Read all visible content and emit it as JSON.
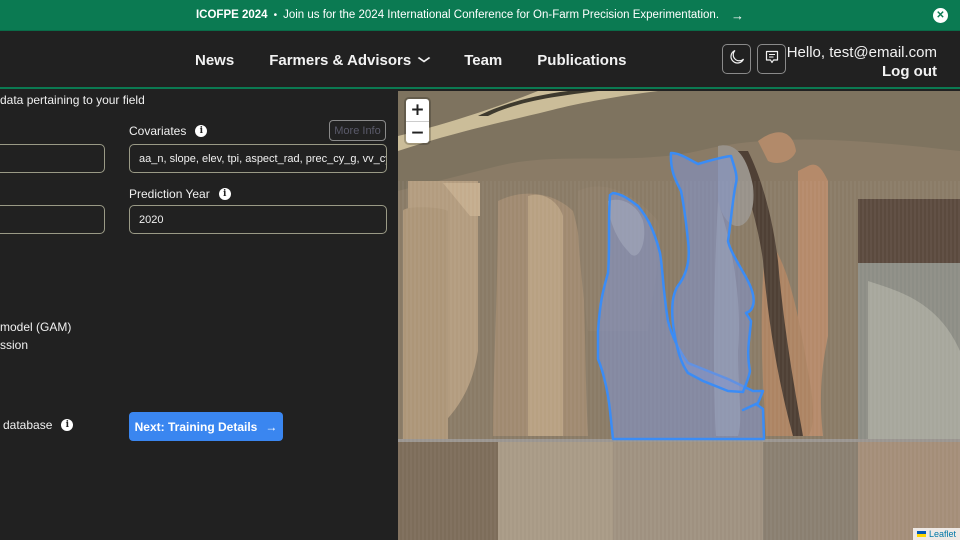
{
  "banner": {
    "title": "ICOFPE 2024",
    "separator": "•",
    "message": "Join us for the 2024 International Conference for On-Farm Precision Experimentation.",
    "arrow_icon": "→",
    "close_icon": "✕",
    "bg_color": "#0b7a52"
  },
  "nav": {
    "links": [
      {
        "label": "News"
      },
      {
        "label": "Farmers & Advisors",
        "has_dropdown": true,
        "chevron": "⌄"
      },
      {
        "label": "Team"
      },
      {
        "label": "Publications"
      }
    ],
    "theme_toggle_icon": "moon-icon",
    "feedback_icon": "chat-icon",
    "user_greeting": "Hello, test@email.com",
    "logout_label": "Log out"
  },
  "form": {
    "intro": "data pertaining to your field",
    "covariates": {
      "label": "Covariates",
      "more_info_label": "More Info",
      "value": "aa_n, slope, elev, tpi, aspect_rad, prec_cy_g, vv_cy_f, v"
    },
    "prediction_year": {
      "label": "Prediction Year",
      "value": "2020"
    },
    "left_inputs": [
      {
        "value": ""
      },
      {
        "value": ""
      }
    ],
    "options": [
      {
        "label": "model (GAM)"
      },
      {
        "label": "ssion"
      }
    ],
    "database_label": "database",
    "next_button": {
      "label": "Next: Training Details",
      "icon": "→",
      "color": "#3a86f0"
    }
  },
  "map": {
    "zoom_in": "+",
    "zoom_out": "−",
    "attribution": "Leaflet",
    "field_outline_color": "#3b8cf5"
  }
}
